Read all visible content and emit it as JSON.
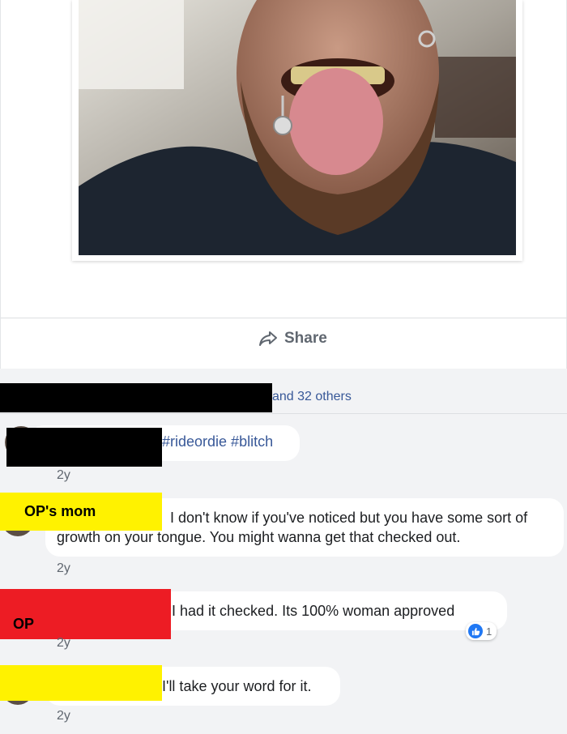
{
  "post": {
    "photo": {
      "description_icon": "photo-icon"
    },
    "share_label": "Share"
  },
  "likes": {
    "text": "and 32 others"
  },
  "comments": [
    {
      "text_hashtags": "#rideordie #blitch",
      "time": "2y"
    },
    {
      "label": "OP's mom",
      "text": "I don't know if you've noticed but you have some sort of growth on your tongue. You might wanna get that checked out.",
      "time": "2y"
    },
    {
      "label": "OP",
      "text": "I had it checked. Its 100% woman approved",
      "time": "2y",
      "reaction_count": "1"
    },
    {
      "text": "I'll take your word for it.",
      "time": "2y"
    }
  ],
  "colors": {
    "label_yellow": "#fff200",
    "label_red": "#ed1c24",
    "link_blue": "#385898",
    "like_blue": "#2078f4"
  }
}
